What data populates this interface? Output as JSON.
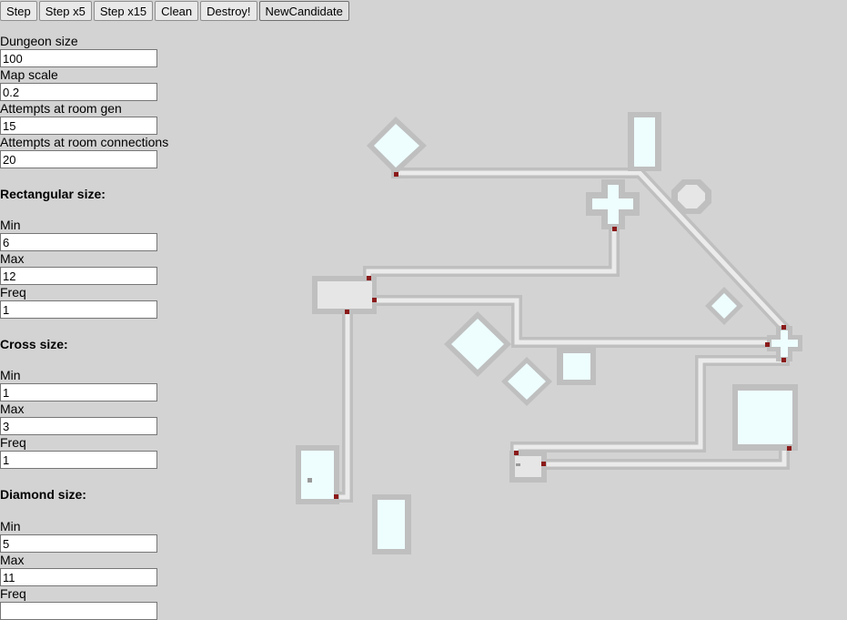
{
  "toolbar": {
    "buttons": [
      "Step",
      "Step x5",
      "Step x15",
      "Clean",
      "Destroy!",
      "NewCandidate"
    ]
  },
  "settings": {
    "dungeon_size": {
      "label": "Dungeon size",
      "value": "100"
    },
    "map_scale": {
      "label": "Map scale",
      "value": "0.2"
    },
    "attempts_room_gen": {
      "label": "Attempts at room gen",
      "value": "15"
    },
    "attempts_room_connections": {
      "label": "Attempts at room connections",
      "value": "20"
    }
  },
  "rectangular": {
    "heading": "Rectangular size:",
    "min": {
      "label": "Min",
      "value": "6"
    },
    "max": {
      "label": "Max",
      "value": "12"
    },
    "freq": {
      "label": "Freq",
      "value": "1"
    }
  },
  "cross": {
    "heading": "Cross size:",
    "min": {
      "label": "Min",
      "value": "1"
    },
    "max": {
      "label": "Max",
      "value": "3"
    },
    "freq": {
      "label": "Freq",
      "value": "1"
    }
  },
  "diamond": {
    "heading": "Diamond size:",
    "min": {
      "label": "Min",
      "value": "5"
    },
    "max": {
      "label": "Max",
      "value": "11"
    },
    "freq": {
      "label": "Freq",
      "value": ""
    }
  },
  "colors": {
    "background": "#d3d3d3",
    "wall": "#bfbfbf",
    "floor": "#ebebeb",
    "room_fill": "#eefeff",
    "door": "#8b1a1a"
  }
}
